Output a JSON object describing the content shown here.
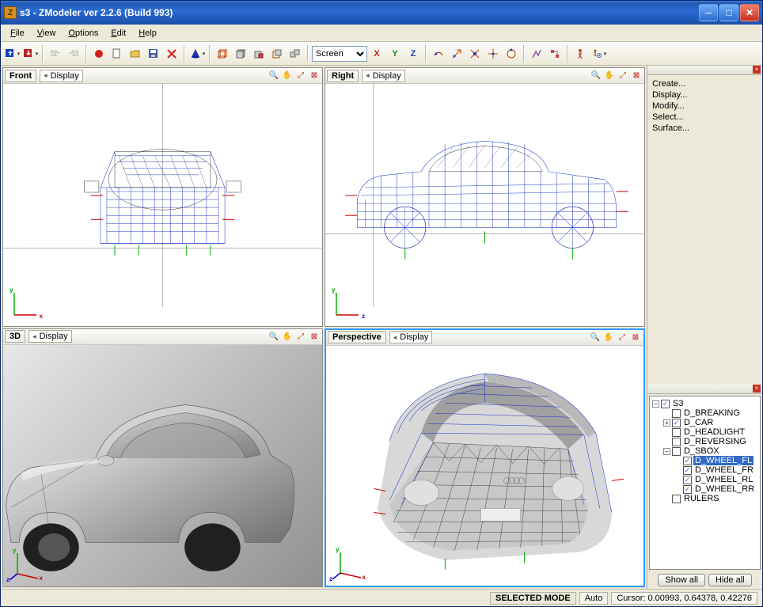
{
  "window": {
    "title": "s3 - ZModeler ver 2.2.6 (Build 993)"
  },
  "menu": {
    "file": "File",
    "view": "View",
    "options": "Options",
    "edit": "Edit",
    "help": "Help"
  },
  "toolbar": {
    "combo": "Screen",
    "axis_x": "X",
    "axis_y": "Y",
    "axis_z": "Z"
  },
  "viewports": {
    "front": {
      "label": "Front",
      "display": "Display",
      "axis1": "y",
      "axis2": "x"
    },
    "right": {
      "label": "Right",
      "display": "Display",
      "axis1": "y",
      "axis2": "z"
    },
    "threeD": {
      "label": "3D",
      "display": "Display",
      "axis1": "y",
      "axis2": "z",
      "axis3": "x"
    },
    "perspective": {
      "label": "Perspective",
      "display": "Display",
      "axis1": "y",
      "axis2": "z",
      "axis3": "x"
    }
  },
  "commands": [
    "Create...",
    "Display...",
    "Modify...",
    "Select...",
    "Surface..."
  ],
  "tree": {
    "root": "S3",
    "items": [
      {
        "label": "D_BREAKING",
        "checked": false,
        "indent": 1
      },
      {
        "label": "D_CAR",
        "checked": true,
        "indent": 1,
        "expandable": true
      },
      {
        "label": "D_HEADLIGHT",
        "checked": false,
        "indent": 1
      },
      {
        "label": "D_REVERSING",
        "checked": false,
        "indent": 1
      },
      {
        "label": "D_SBOX",
        "checked": false,
        "indent": 1,
        "expandable": true,
        "expanded": true
      },
      {
        "label": "D_WHEEL_FL",
        "checked": true,
        "indent": 2,
        "selected": true
      },
      {
        "label": "D_WHEEL_FR",
        "checked": true,
        "indent": 2
      },
      {
        "label": "D_WHEEL_RL",
        "checked": true,
        "indent": 2
      },
      {
        "label": "D_WHEEL_RR",
        "checked": true,
        "indent": 2
      },
      {
        "label": "RULERS",
        "checked": false,
        "indent": 1
      }
    ],
    "show_all": "Show all",
    "hide_all": "Hide all"
  },
  "status": {
    "mode": "SELECTED MODE",
    "auto": "Auto",
    "cursor": "Cursor: 0.00993, 0.64378, 0.42276"
  }
}
